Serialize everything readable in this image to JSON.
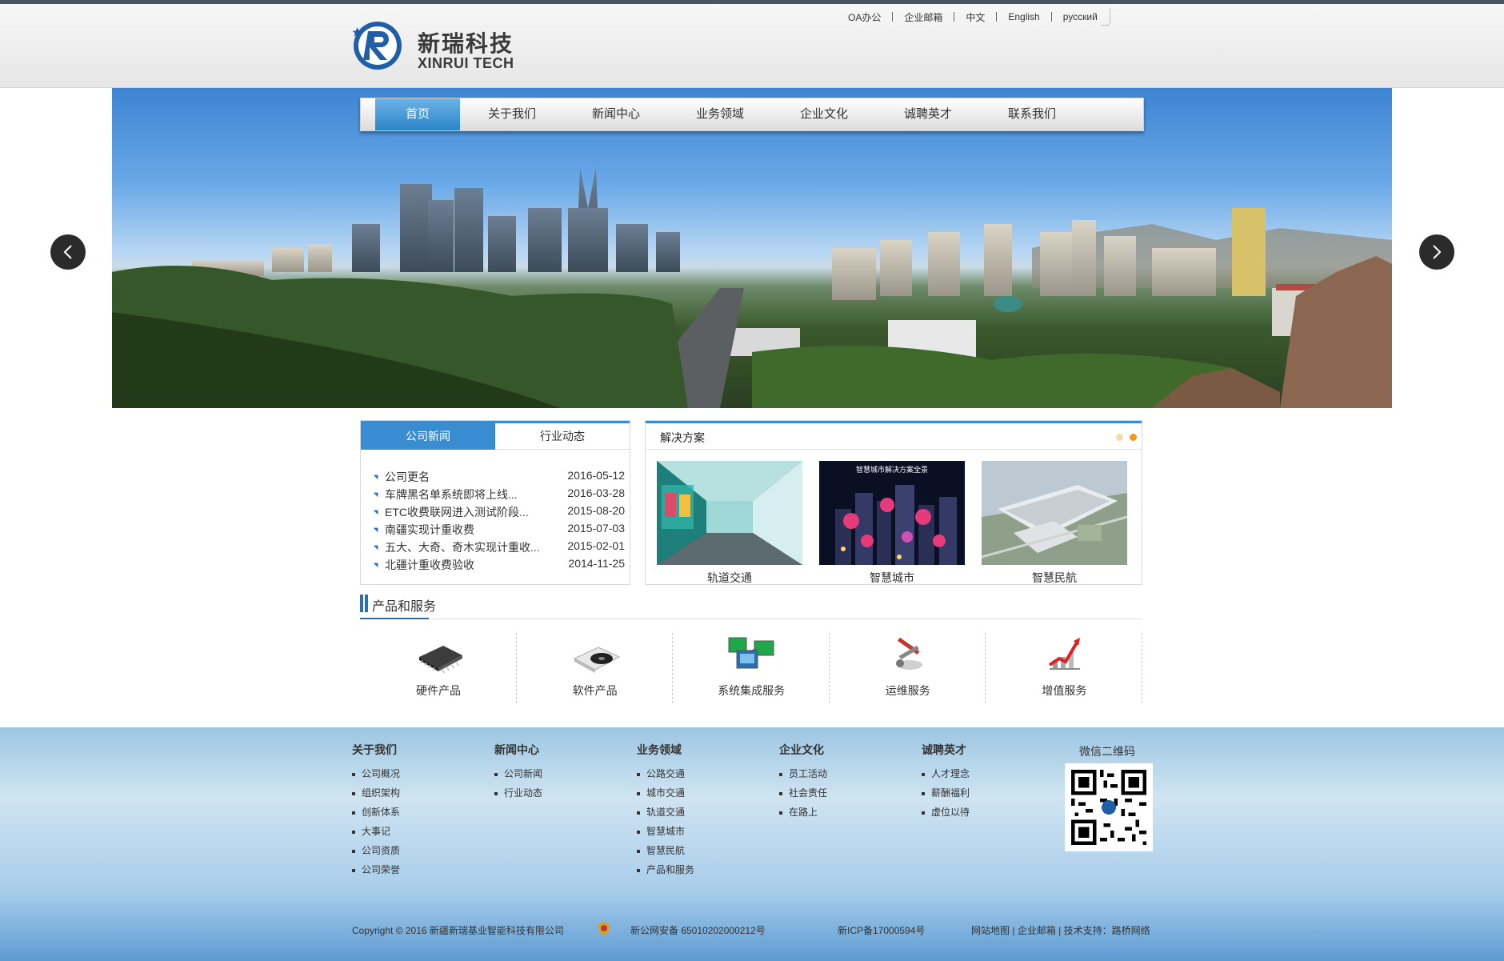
{
  "header": {
    "logo_cn": "新瑞科技",
    "logo_en": "XINRUI TECH",
    "top_links": [
      "OA办公",
      "企业邮箱",
      "中文",
      "English",
      "русский"
    ]
  },
  "nav": {
    "items": [
      "首页",
      "关于我们",
      "新闻中心",
      "业务领域",
      "企业文化",
      "诚聘英才",
      "联系我们"
    ],
    "active_index": 0
  },
  "banner": {
    "prev_icon": "chevron-left-icon",
    "next_icon": "chevron-right-icon"
  },
  "news": {
    "tabs": [
      "公司新闻",
      "行业动态"
    ],
    "rows": [
      {
        "title": "公司更名",
        "date": "2016-05-12"
      },
      {
        "title": "车牌黑名单系统即将上线...",
        "date": "2016-03-28"
      },
      {
        "title": "ETC收费联网进入测试阶段...",
        "date": "2015-08-20"
      },
      {
        "title": "南疆实现计重收费",
        "date": "2015-07-03"
      },
      {
        "title": "五大、大奇、奇木实现计重收...",
        "date": "2015-02-01"
      },
      {
        "title": "北疆计重收费验收",
        "date": "2014-11-25"
      }
    ]
  },
  "solutions": {
    "title": "解决方案",
    "items": [
      "轨道交通",
      "智慧城市",
      "智慧民航"
    ],
    "image_text": "智慧城市解决方案全景"
  },
  "products": {
    "title": "产品和服务",
    "items": [
      "硬件产品",
      "软件产品",
      "系统集成服务",
      "运维服务",
      "增值服务"
    ]
  },
  "footer": {
    "columns": [
      {
        "title": "关于我们",
        "links": [
          "公司概况",
          "组织架构",
          "创新体系",
          "大事记",
          "公司资质",
          "公司荣誉"
        ]
      },
      {
        "title": "新闻中心",
        "links": [
          "公司新闻",
          "行业动态"
        ]
      },
      {
        "title": "业务领域",
        "links": [
          "公路交通",
          "城市交通",
          "轨道交通",
          "智慧城市",
          "智慧民航",
          "产品和服务"
        ]
      },
      {
        "title": "企业文化",
        "links": [
          "员工活动",
          "社会责任",
          "在路上"
        ]
      },
      {
        "title": "诚聘英才",
        "links": [
          "人才理念",
          "薪酬福利",
          "虚位以待"
        ]
      }
    ],
    "qr_title": "微信二维码",
    "copyright": "Copyright © 2016 新疆新瑞基业智能科技有限公司",
    "police": "新公网安备 65010202000212号",
    "icp": "新ICP备17000594号",
    "bottom_links": [
      "网站地图",
      "企业邮箱",
      "技术支持：路桥网络"
    ]
  },
  "colors": {
    "accent": "#3a8cd0",
    "nav_active": "#2b85c7",
    "dot_active": "#f39a1a",
    "footer_blue": "#5d9bd3"
  }
}
